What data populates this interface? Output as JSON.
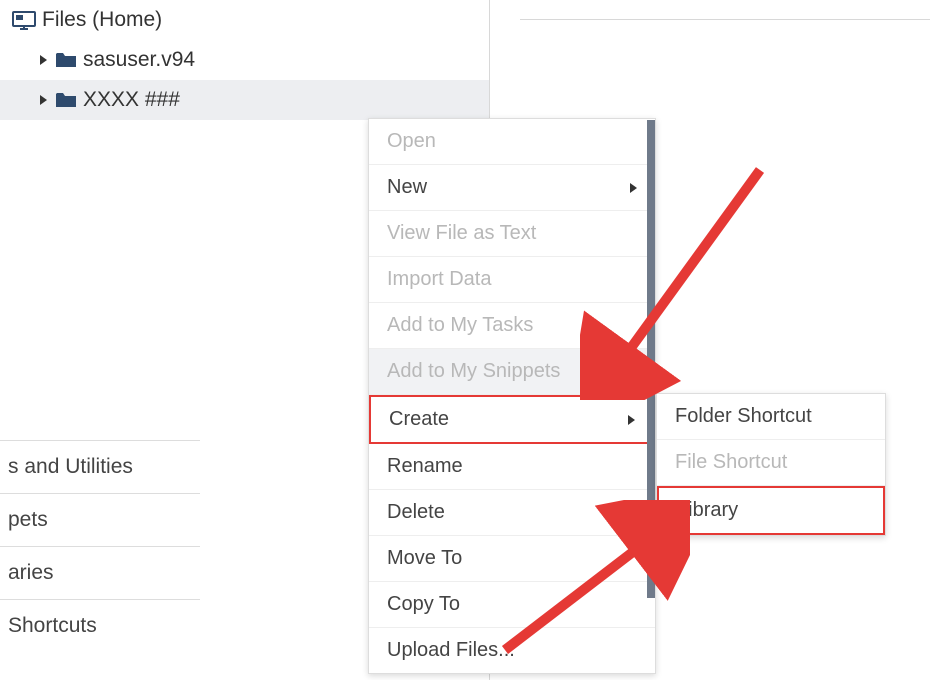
{
  "tree": {
    "root_label": "Files (Home)",
    "items": [
      {
        "label": "sasuser.v94",
        "selected": false
      },
      {
        "label": "XXXX ###",
        "selected": true
      }
    ]
  },
  "sections": [
    "s and Utilities",
    "pets",
    "aries",
    "Shortcuts"
  ],
  "context_menu": [
    {
      "label": "Open",
      "disabled": true,
      "submenu": false
    },
    {
      "label": "New",
      "disabled": false,
      "submenu": true
    },
    {
      "label": "View File as Text",
      "disabled": true,
      "submenu": false
    },
    {
      "label": "Import Data",
      "disabled": true,
      "submenu": false
    },
    {
      "label": "Add to My Tasks",
      "disabled": true,
      "submenu": false
    },
    {
      "label": "Add to My Snippets",
      "disabled": true,
      "submenu": false,
      "hover": true
    },
    {
      "label": "Create",
      "disabled": false,
      "submenu": true,
      "highlight": true
    },
    {
      "label": "Rename",
      "disabled": false,
      "submenu": false
    },
    {
      "label": "Delete",
      "disabled": false,
      "submenu": false
    },
    {
      "label": "Move To",
      "disabled": false,
      "submenu": false
    },
    {
      "label": "Copy To",
      "disabled": false,
      "submenu": false
    },
    {
      "label": "Upload Files...",
      "disabled": false,
      "submenu": false
    }
  ],
  "submenu": [
    {
      "label": "Folder Shortcut",
      "disabled": false,
      "highlight": false
    },
    {
      "label": "File Shortcut",
      "disabled": true,
      "highlight": false
    },
    {
      "label": "Library",
      "disabled": false,
      "highlight": true
    }
  ],
  "colors": {
    "folder": "#2e4a6d",
    "highlight": "#e53935"
  }
}
